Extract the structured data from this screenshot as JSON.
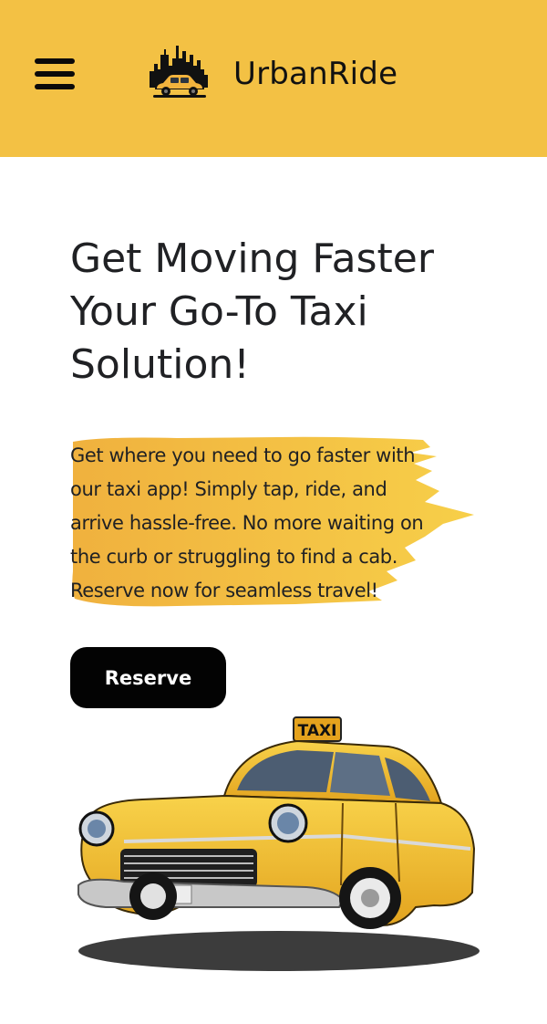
{
  "header": {
    "brand_name": "UrbanRide",
    "menu_icon": "hamburger-menu-icon",
    "logo_icon": "city-skyline-taxi-logo",
    "background_color": "#f3c144"
  },
  "hero": {
    "title_lines": [
      "Get Moving Faster",
      "Your Go-To Taxi",
      "Solution!"
    ],
    "description_lines": [
      "Get where you need to go faster with",
      "our taxi app! Simply tap, ride, and",
      "arrive hassle-free. No more waiting on",
      "the curb or struggling to find a cab.",
      "Reserve now for seamless travel!"
    ],
    "highlight_color": "#f3bf3f",
    "reserve_label": "Reserve",
    "taxi_sign_text": "TAXI",
    "taxi_image_icon": "yellow-classic-taxi-illustration"
  }
}
